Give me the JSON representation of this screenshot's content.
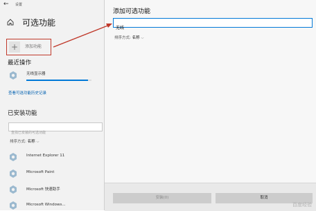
{
  "window": {
    "app_title": "设置"
  },
  "left": {
    "page_title": "可选功能",
    "add_feature_label": "添加功能",
    "recent_section_title": "最近操作",
    "recent_items": [
      {
        "name": "无线显示器",
        "progress": 0.95
      }
    ],
    "history_link": "查看可选功能历史记录",
    "installed_section_title": "已安装功能",
    "search_placeholder": "查找已安装的可选功能",
    "sort_label": "排序方式:",
    "sort_value": "名称",
    "installed_items": [
      {
        "name": "Internet Explorer 11"
      },
      {
        "name": "Microsoft Paint"
      },
      {
        "name": "Microsoft 快速助手"
      },
      {
        "name": "Microsoft Windows..."
      }
    ]
  },
  "dialog": {
    "title": "添加可选功能",
    "search_value": "无线",
    "sort_label": "排序方式:",
    "sort_value": "名称",
    "install_button": "安装(0)",
    "cancel_button": "取消"
  },
  "colors": {
    "accent": "#0078d7",
    "highlight_border": "#c0392b",
    "arrow": "#c0392b"
  },
  "icons": {
    "back": "back-arrow-icon",
    "home": "home-icon",
    "feature": "gear-puzzle-icon",
    "sort_dropdown": "chevron-down-icon",
    "add": "plus-icon"
  },
  "watermark": "百度经验"
}
